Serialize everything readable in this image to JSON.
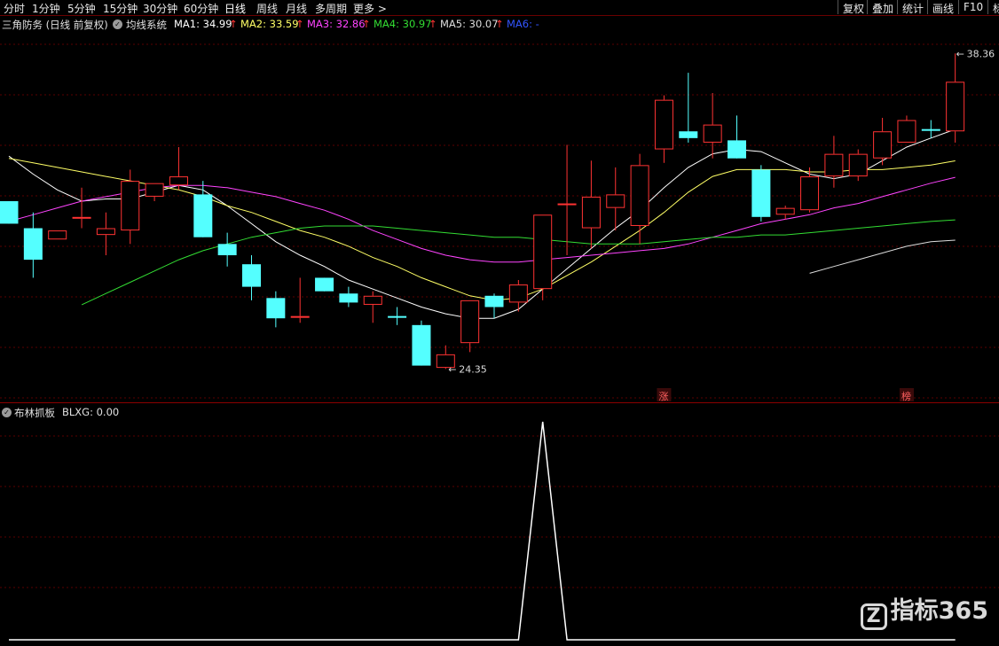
{
  "toolbar": {
    "periods": [
      "分时",
      "1分钟",
      "5分钟",
      "15分钟",
      "30分钟",
      "60分钟",
      "日线",
      "周线",
      "月线",
      "多周期",
      "更多 >"
    ],
    "active_period": "日线",
    "right_buttons": [
      "复权",
      "叠加",
      "统计",
      "画线",
      "F10",
      "标"
    ]
  },
  "legend": {
    "stock_title": "三角防务 (日线 前复权)",
    "indicator": "均线系统",
    "ma": [
      {
        "label": "MA1: 34.99",
        "arrow": "↑",
        "color": "#ffffff"
      },
      {
        "label": "MA2: 33.59",
        "arrow": "↑",
        "color": "#ffff66"
      },
      {
        "label": "MA3: 32.86",
        "arrow": "↑",
        "color": "#ff44ff"
      },
      {
        "label": "MA4: 30.97",
        "arrow": "↑",
        "color": "#33dd33"
      },
      {
        "label": "MA5: 30.07",
        "arrow": "↑",
        "color": "#dddddd"
      },
      {
        "label": "MA6: -",
        "arrow": "",
        "color": "#3355ff"
      }
    ]
  },
  "chart_data": {
    "type": "candlestick",
    "price_labels": {
      "high": "38.36",
      "low": "24.35"
    },
    "ylim": [
      23.5,
      39.0
    ],
    "candles": [
      {
        "o": 30.8,
        "h": 30.8,
        "c": 31.8,
        "l": 31.8,
        "dir": "down"
      },
      {
        "o": 30.6,
        "h": 31.3,
        "c": 29.2,
        "l": 28.4,
        "dir": "down"
      },
      {
        "o": 30.1,
        "h": 30.5,
        "c": 30.5,
        "l": 30.1,
        "dir": "up"
      },
      {
        "o": 31.1,
        "h": 32.4,
        "c": 31.1,
        "l": 30.6,
        "dir": "up"
      },
      {
        "o": 30.3,
        "h": 31.3,
        "c": 30.6,
        "l": 29.4,
        "dir": "up"
      },
      {
        "o": 30.5,
        "h": 33.2,
        "c": 32.7,
        "l": 29.9,
        "dir": "up"
      },
      {
        "o": 32.0,
        "h": 32.6,
        "c": 32.6,
        "l": 31.8,
        "dir": "up"
      },
      {
        "o": 32.5,
        "h": 34.2,
        "c": 32.9,
        "l": 32.3,
        "dir": "up"
      },
      {
        "o": 32.1,
        "h": 32.7,
        "c": 30.2,
        "l": 30.2,
        "dir": "down"
      },
      {
        "o": 29.9,
        "h": 30.4,
        "c": 29.4,
        "l": 28.9,
        "dir": "down"
      },
      {
        "o": 29.0,
        "h": 29.4,
        "c": 28.0,
        "l": 27.4,
        "dir": "down"
      },
      {
        "o": 27.5,
        "h": 27.8,
        "c": 26.6,
        "l": 26.2,
        "dir": "down"
      },
      {
        "o": 26.7,
        "h": 28.4,
        "c": 26.7,
        "l": 26.4,
        "dir": "up"
      },
      {
        "o": 28.4,
        "h": 28.4,
        "c": 27.8,
        "l": 27.8,
        "dir": "down"
      },
      {
        "o": 27.7,
        "h": 28.0,
        "c": 27.3,
        "l": 27.1,
        "dir": "down"
      },
      {
        "o": 27.2,
        "h": 27.8,
        "c": 27.6,
        "l": 26.4,
        "dir": "up"
      },
      {
        "o": 26.7,
        "h": 27.1,
        "c": 26.7,
        "l": 26.3,
        "dir": "down"
      },
      {
        "o": 26.3,
        "h": 26.5,
        "c": 24.5,
        "l": 24.5,
        "dir": "down"
      },
      {
        "o": 24.4,
        "h": 25.4,
        "c": 25.0,
        "l": 24.35,
        "dir": "up"
      },
      {
        "o": 25.5,
        "h": 27.4,
        "c": 27.4,
        "l": 25.1,
        "dir": "up"
      },
      {
        "o": 27.6,
        "h": 27.7,
        "c": 27.1,
        "l": 26.6,
        "dir": "down"
      },
      {
        "o": 27.3,
        "h": 28.3,
        "c": 28.1,
        "l": 26.9,
        "dir": "up"
      },
      {
        "o": 27.9,
        "h": 31.2,
        "c": 31.2,
        "l": 27.4,
        "dir": "up"
      },
      {
        "o": 31.7,
        "h": 34.3,
        "c": 31.7,
        "l": 29.4,
        "dir": "up"
      },
      {
        "o": 30.6,
        "h": 33.6,
        "c": 32.0,
        "l": 29.7,
        "dir": "up"
      },
      {
        "o": 31.5,
        "h": 33.3,
        "c": 32.1,
        "l": 30.5,
        "dir": "up"
      },
      {
        "o": 30.7,
        "h": 33.9,
        "c": 33.4,
        "l": 29.9,
        "dir": "up"
      },
      {
        "o": 34.1,
        "h": 36.5,
        "c": 36.3,
        "l": 33.5,
        "dir": "up"
      },
      {
        "o": 34.6,
        "h": 37.5,
        "c": 34.9,
        "l": 34.4,
        "dir": "down"
      },
      {
        "o": 34.4,
        "h": 36.6,
        "c": 35.2,
        "l": 33.7,
        "dir": "up"
      },
      {
        "o": 34.5,
        "h": 35.6,
        "c": 33.7,
        "l": 33.7,
        "dir": "down"
      },
      {
        "o": 33.2,
        "h": 33.4,
        "c": 31.1,
        "l": 30.9,
        "dir": "down"
      },
      {
        "o": 31.2,
        "h": 31.6,
        "c": 31.5,
        "l": 31.0,
        "dir": "up"
      },
      {
        "o": 31.4,
        "h": 33.3,
        "c": 32.9,
        "l": 31.3,
        "dir": "up"
      },
      {
        "o": 32.9,
        "h": 34.7,
        "c": 33.9,
        "l": 32.4,
        "dir": "up"
      },
      {
        "o": 32.9,
        "h": 34.1,
        "c": 33.9,
        "l": 32.7,
        "dir": "up"
      },
      {
        "o": 33.7,
        "h": 35.5,
        "c": 34.9,
        "l": 33.4,
        "dir": "up"
      },
      {
        "o": 34.4,
        "h": 35.6,
        "c": 35.4,
        "l": 34.4,
        "dir": "up"
      },
      {
        "o": 35.0,
        "h": 35.4,
        "c": 35.0,
        "l": 34.6,
        "dir": "down"
      },
      {
        "o": 34.9,
        "h": 38.36,
        "c": 37.1,
        "l": 34.4,
        "dir": "up"
      }
    ],
    "ma_lines": {
      "MA1": [
        33.8,
        33.0,
        32.3,
        31.8,
        31.9,
        31.9,
        32.2,
        32.5,
        32.3,
        31.6,
        30.8,
        30.0,
        29.4,
        28.9,
        28.3,
        27.9,
        27.5,
        27.1,
        26.8,
        26.6,
        26.6,
        27.0,
        27.9,
        28.8,
        29.7,
        30.6,
        31.4,
        32.4,
        33.3,
        33.9,
        34.1,
        34.0,
        33.5,
        33.0,
        32.8,
        33.0,
        33.6,
        34.2,
        34.6,
        34.99
      ],
      "MA2": [
        33.7,
        33.5,
        33.3,
        33.1,
        32.9,
        32.7,
        32.5,
        32.3,
        32.0,
        31.6,
        31.3,
        30.9,
        30.5,
        30.2,
        29.8,
        29.3,
        28.9,
        28.4,
        28.0,
        27.6,
        27.4,
        27.5,
        27.9,
        28.5,
        29.1,
        29.8,
        30.5,
        31.3,
        32.2,
        32.9,
        33.2,
        33.2,
        33.2,
        33.1,
        33.1,
        33.2,
        33.2,
        33.3,
        33.4,
        33.59
      ],
      "MA3": [
        30.9,
        31.2,
        31.5,
        31.8,
        32.0,
        32.2,
        32.4,
        32.5,
        32.5,
        32.4,
        32.2,
        32.0,
        31.7,
        31.4,
        31.0,
        30.5,
        30.1,
        29.7,
        29.4,
        29.2,
        29.1,
        29.1,
        29.2,
        29.3,
        29.4,
        29.5,
        29.6,
        29.7,
        29.9,
        30.2,
        30.5,
        30.8,
        31.0,
        31.2,
        31.5,
        31.7,
        32.0,
        32.3,
        32.6,
        32.86
      ],
      "MA4": [
        null,
        null,
        null,
        27.2,
        27.7,
        28.2,
        28.7,
        29.2,
        29.6,
        29.9,
        30.2,
        30.4,
        30.6,
        30.7,
        30.7,
        30.7,
        30.6,
        30.5,
        30.4,
        30.3,
        30.2,
        30.2,
        30.1,
        30.0,
        29.9,
        29.9,
        29.9,
        30.0,
        30.1,
        30.2,
        30.2,
        30.3,
        30.3,
        30.4,
        30.5,
        30.6,
        30.7,
        30.8,
        30.9,
        30.97
      ],
      "MA5": [
        null,
        null,
        null,
        null,
        null,
        null,
        null,
        null,
        null,
        null,
        null,
        null,
        null,
        null,
        null,
        null,
        null,
        null,
        null,
        null,
        null,
        null,
        null,
        null,
        null,
        null,
        null,
        null,
        null,
        null,
        null,
        null,
        null,
        28.6,
        28.9,
        29.2,
        29.5,
        29.8,
        30.0,
        30.07
      ]
    },
    "markers": [
      {
        "candle": 27,
        "text": "涨"
      },
      {
        "candle": 37,
        "text": "榜"
      }
    ]
  },
  "indicator_panel": {
    "title": "布林抓板",
    "value_label": "BLXG: 0.00",
    "chart_data": {
      "type": "line",
      "ylim": [
        0,
        1
      ],
      "points": [
        {
          "candle": 0,
          "v": 0
        },
        {
          "candle": 21,
          "v": 0
        },
        {
          "candle": 22,
          "v": 1
        },
        {
          "candle": 23,
          "v": 0
        },
        {
          "candle": 39,
          "v": 0
        }
      ]
    }
  },
  "watermark": "指标365"
}
